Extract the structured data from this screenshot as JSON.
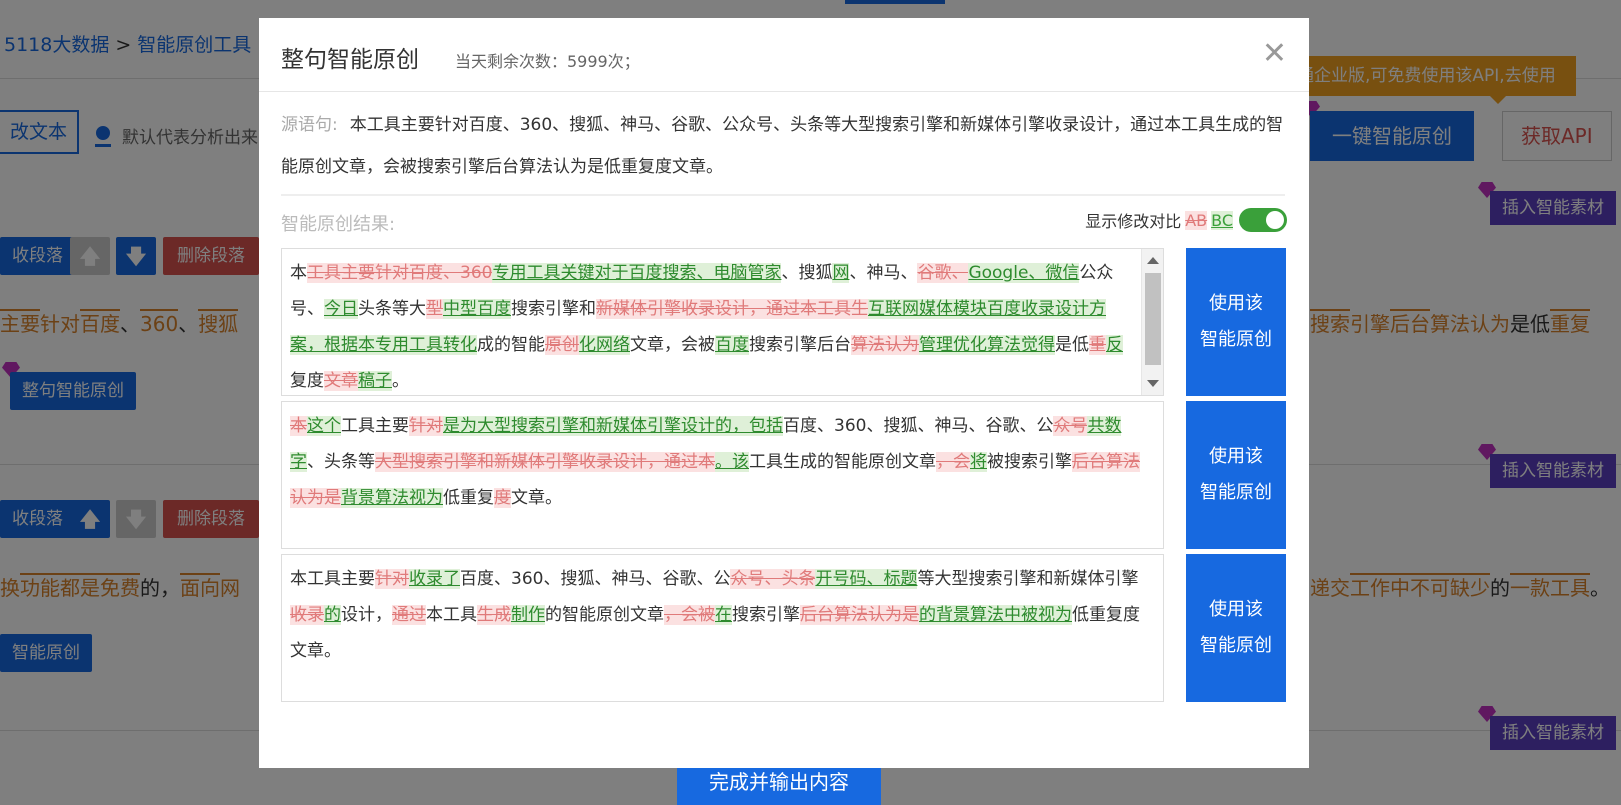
{
  "background": {
    "breadcrumb": [
      "5118大数据",
      "智能原创工具"
    ],
    "breadcrumb_sep": ">",
    "modify_text_btn": "改文本",
    "radio_label": "默认代表分析出来",
    "tooltip": "开通企业版,可免费使用该API,去使用",
    "smart_btn": "一键智能原创",
    "get_api_btn": "获取API",
    "insert_material": "插入智能素材",
    "para_btn": "收段落",
    "para_btn2": "收段落",
    "up_arrow": "🡅",
    "down_arrow": "🡇",
    "delete_para": "删除段落",
    "sentence_btn": "整句智能原创",
    "row1_left": [
      "主要",
      "针对",
      "百度",
      "、",
      "360",
      "、",
      "搜狐"
    ],
    "row1_right": [
      "搜索",
      "引擎",
      "后台",
      "算法",
      "认为",
      "是低",
      "重复"
    ],
    "row2_left": [
      "换",
      "功能",
      "都是",
      "免费",
      "的，",
      "面向",
      "网"
    ],
    "row2_right": [
      "递交",
      "工作",
      "中",
      "不可缺少",
      "的",
      "一款",
      "工具",
      "。"
    ],
    "smart_label": "智能原创",
    "finish_btn": "完成并输出内容"
  },
  "modal": {
    "title": "整句智能原创",
    "remain": "当天剩余次数：5999次；",
    "source_label": "源语句:",
    "source_text": "本工具主要针对百度、360、搜狐、神马、谷歌、公众号、头条等大型搜索引擎和新媒体引擎收录设计，通过本工具生成的智能原创文章，会被搜索引擎后台算法认为是低重复度文章。",
    "result_label": "智能原创结果:",
    "compare_label": "显示修改对比",
    "compare_del": "AB",
    "compare_add": "BC",
    "use_btn_line1": "使用该",
    "use_btn_line2": "智能原创",
    "results": [
      [
        [
          "n",
          "本"
        ],
        [
          "d",
          "工具主要针对百度、360"
        ],
        [
          "a",
          "专用工具关键对于百度搜索、电脑管家"
        ],
        [
          "n",
          "、搜狐"
        ],
        [
          "a",
          "网"
        ],
        [
          "n",
          "、神马、"
        ],
        [
          "d",
          "谷歌、"
        ],
        [
          "a",
          "Google、微信"
        ],
        [
          "n",
          "公众号、"
        ],
        [
          "a",
          "今日"
        ],
        [
          "n",
          "头条等大"
        ],
        [
          "d",
          "型"
        ],
        [
          "a",
          "中型百度"
        ],
        [
          "n",
          "搜索引擎和"
        ],
        [
          "d",
          "新媒体引擎收录设计，通过本工具生"
        ],
        [
          "a",
          "互联网媒体模块百度收录设计方案，根据本专用工具转化"
        ],
        [
          "n",
          "成的智能"
        ],
        [
          "d",
          "原创"
        ],
        [
          "a",
          "化网络"
        ],
        [
          "n",
          "文章，会被"
        ],
        [
          "a",
          "百度"
        ],
        [
          "n",
          "搜索引擎后台"
        ],
        [
          "d",
          "算法认为"
        ],
        [
          "a",
          "管理优化算法觉得"
        ],
        [
          "n",
          "是低"
        ],
        [
          "d",
          "重"
        ],
        [
          "a",
          "反"
        ],
        [
          "n",
          "复度"
        ],
        [
          "d",
          "文章"
        ],
        [
          "a",
          "稿子"
        ],
        [
          "n",
          "。"
        ]
      ],
      [
        [
          "d",
          "本"
        ],
        [
          "a",
          "这个"
        ],
        [
          "n",
          "工具主要"
        ],
        [
          "d",
          "针对"
        ],
        [
          "a",
          "是为大型搜索引擎和新媒体引擎设计的，包括"
        ],
        [
          "n",
          "百度、360、搜狐、神马、谷歌、公"
        ],
        [
          "d",
          "众号"
        ],
        [
          "a",
          "共数字"
        ],
        [
          "n",
          "、头条等"
        ],
        [
          "d",
          "大型搜索引擎和新媒体引擎收录设计，通过本"
        ],
        [
          "a",
          "。该"
        ],
        [
          "n",
          "工具生成的智能原创文章"
        ],
        [
          "d",
          "，会"
        ],
        [
          "a",
          "将"
        ],
        [
          "n",
          "被搜索引擎"
        ],
        [
          "d",
          "后台算法认为是"
        ],
        [
          "a",
          "背景算法视为"
        ],
        [
          "n",
          "低重复"
        ],
        [
          "d",
          "度"
        ],
        [
          "n",
          "文章。"
        ]
      ],
      [
        [
          "n",
          "本工具主要"
        ],
        [
          "d",
          "针对"
        ],
        [
          "a",
          "收录了"
        ],
        [
          "n",
          "百度、360、搜狐、神马、谷歌、公"
        ],
        [
          "d",
          "众号、头条"
        ],
        [
          "a",
          "开号码、标题"
        ],
        [
          "n",
          "等大型搜索引擎和新媒体引擎"
        ],
        [
          "d",
          "收录"
        ],
        [
          "a",
          "的"
        ],
        [
          "n",
          "设计，"
        ],
        [
          "d",
          "通过"
        ],
        [
          "n",
          "本工具"
        ],
        [
          "d",
          "生成"
        ],
        [
          "a",
          "制作"
        ],
        [
          "n",
          "的智能原创文章"
        ],
        [
          "d",
          "，会被"
        ],
        [
          "a",
          "在"
        ],
        [
          "n",
          "搜索引擎"
        ],
        [
          "d",
          "后台算法认为是"
        ],
        [
          "a",
          "的背景算法中被视为"
        ],
        [
          "n",
          "低重复度文章。"
        ]
      ]
    ]
  },
  "colors": {
    "primary": "#1769e0",
    "danger": "#d9534f",
    "orange": "#d9822b",
    "purple": "#5a3fc0",
    "toggle": "#3aa03a"
  }
}
